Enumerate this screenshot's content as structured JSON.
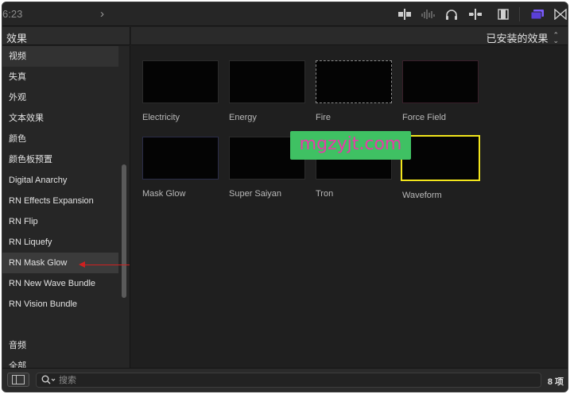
{
  "toolbar": {
    "time": "6:23",
    "icons": [
      "chevron-right-icon",
      "audio-skimming-icon",
      "audio-waveform-icon",
      "headphones-icon",
      "snapping-icon",
      "video-clip-icon",
      "effects-browser-icon",
      "transitions-icon"
    ],
    "accent": "#7b5cff"
  },
  "sidebar": {
    "title": "效果",
    "items": [
      {
        "label": "视频",
        "type": "category"
      },
      {
        "label": "失真"
      },
      {
        "label": "外观"
      },
      {
        "label": "文本效果"
      },
      {
        "label": "颜色"
      },
      {
        "label": "颜色板预置"
      },
      {
        "label": "Digital Anarchy"
      },
      {
        "label": "RN Effects Expansion"
      },
      {
        "label": "RN Flip"
      },
      {
        "label": "RN Liquefy"
      },
      {
        "label": "RN Mask Glow",
        "selected": true
      },
      {
        "label": "RN New Wave Bundle"
      },
      {
        "label": "RN Vision Bundle"
      },
      {
        "label": ""
      },
      {
        "label": "音频"
      },
      {
        "label": "全部"
      }
    ]
  },
  "main": {
    "filter": "已安装的效果",
    "effects": [
      {
        "label": "Electricity"
      },
      {
        "label": "Energy"
      },
      {
        "label": "Fire"
      },
      {
        "label": "Force Field"
      },
      {
        "label": "Mask Glow"
      },
      {
        "label": "Super Saiyan"
      },
      {
        "label": "Tron"
      },
      {
        "label": "Waveform",
        "selected": true
      }
    ],
    "selection_color": "#f2e51c"
  },
  "watermark": "mgzyjt.com",
  "footer": {
    "search_placeholder": "搜索",
    "count": "8 项"
  }
}
